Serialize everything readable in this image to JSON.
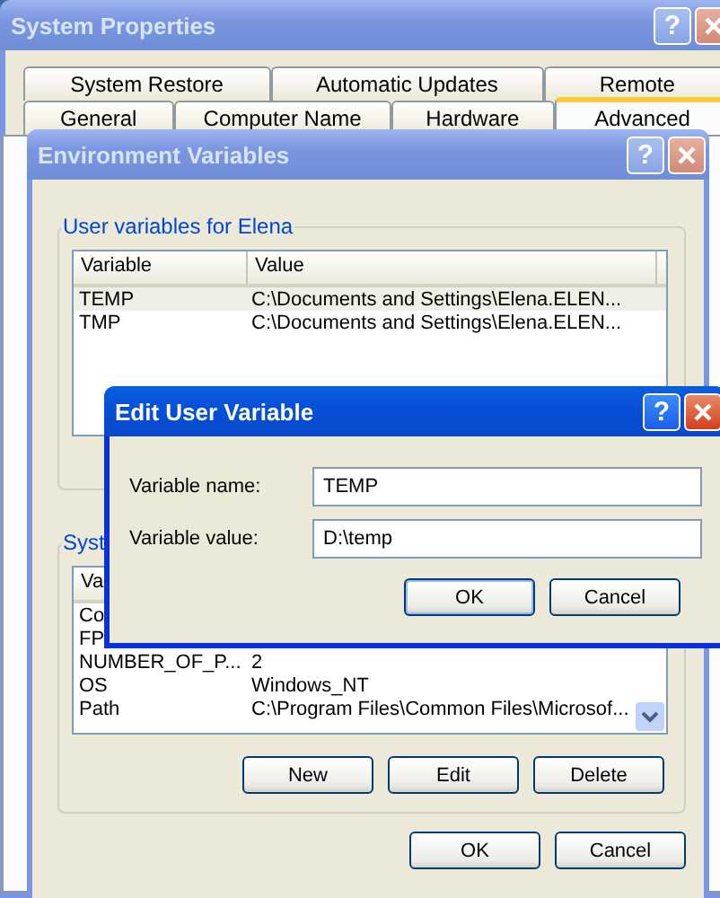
{
  "system_properties": {
    "title": "System Properties",
    "help": "?",
    "active": false,
    "tab_rows": [
      [
        {
          "label": "System Restore",
          "selected": false
        },
        {
          "label": "Automatic Updates",
          "selected": false
        },
        {
          "label": "Remote",
          "selected": false
        }
      ],
      [
        {
          "label": "General",
          "selected": false
        },
        {
          "label": "Computer Name",
          "selected": false
        },
        {
          "label": "Hardware",
          "selected": false
        },
        {
          "label": "Advanced",
          "selected": true
        }
      ]
    ]
  },
  "environment_variables": {
    "title": "Environment Variables",
    "help": "?",
    "active": false,
    "user_group": {
      "label": "User variables for Elena",
      "columns": [
        "Variable",
        "Value"
      ],
      "rows": [
        {
          "variable": "TEMP",
          "value": "C:\\Documents and Settings\\Elena.ELEN...",
          "selected": true
        },
        {
          "variable": "TMP",
          "value": "C:\\Documents and Settings\\Elena.ELEN...",
          "selected": false
        }
      ]
    },
    "system_group": {
      "label": "Syst",
      "columns": [
        "Va"
      ],
      "rows": [
        {
          "variable": "Co",
          "selected": false
        },
        {
          "variable": "FP",
          "selected": false
        },
        {
          "variable": "NUMBER_OF_P...",
          "value": "2",
          "selected": false
        },
        {
          "variable": "OS",
          "value": "Windows_NT",
          "selected": false
        },
        {
          "variable": "Path",
          "value": "C:\\Program Files\\Common Files\\Microsof...",
          "selected": false
        }
      ],
      "buttons": [
        "New",
        "Edit",
        "Delete"
      ]
    },
    "buttons": [
      "OK",
      "Cancel"
    ]
  },
  "edit_user_variable": {
    "title": "Edit User Variable",
    "help": "?",
    "active": true,
    "fields": [
      {
        "label": "Variable name:",
        "value": "TEMP"
      },
      {
        "label": "Variable value:",
        "value": "D:\\temp"
      }
    ],
    "buttons": [
      "OK",
      "Cancel"
    ]
  }
}
